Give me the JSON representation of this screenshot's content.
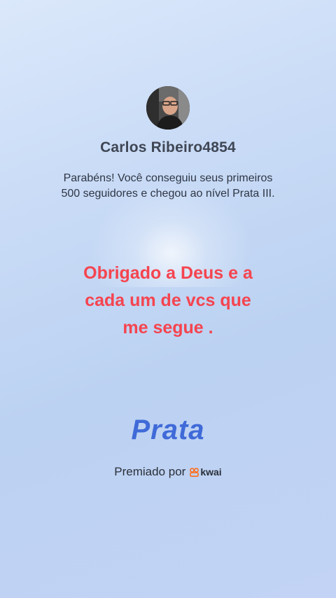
{
  "profile": {
    "username": "Carlos Ribeiro4854"
  },
  "message": {
    "line1": "Parabéns! Você conseguiu seus primeiros",
    "line2": "500 seguidores e chegou ao nível Prata III."
  },
  "caption": {
    "line1": "Obrigado a Deus e a",
    "line2": "cada um de vcs que",
    "line3": "me segue ."
  },
  "level": {
    "name": "Prata"
  },
  "awarded": {
    "label": "Premiado por",
    "brand": "kwai"
  },
  "colors": {
    "caption": "#f5444f",
    "level": "#3f6ad8",
    "brand": "#ff6d1a"
  }
}
